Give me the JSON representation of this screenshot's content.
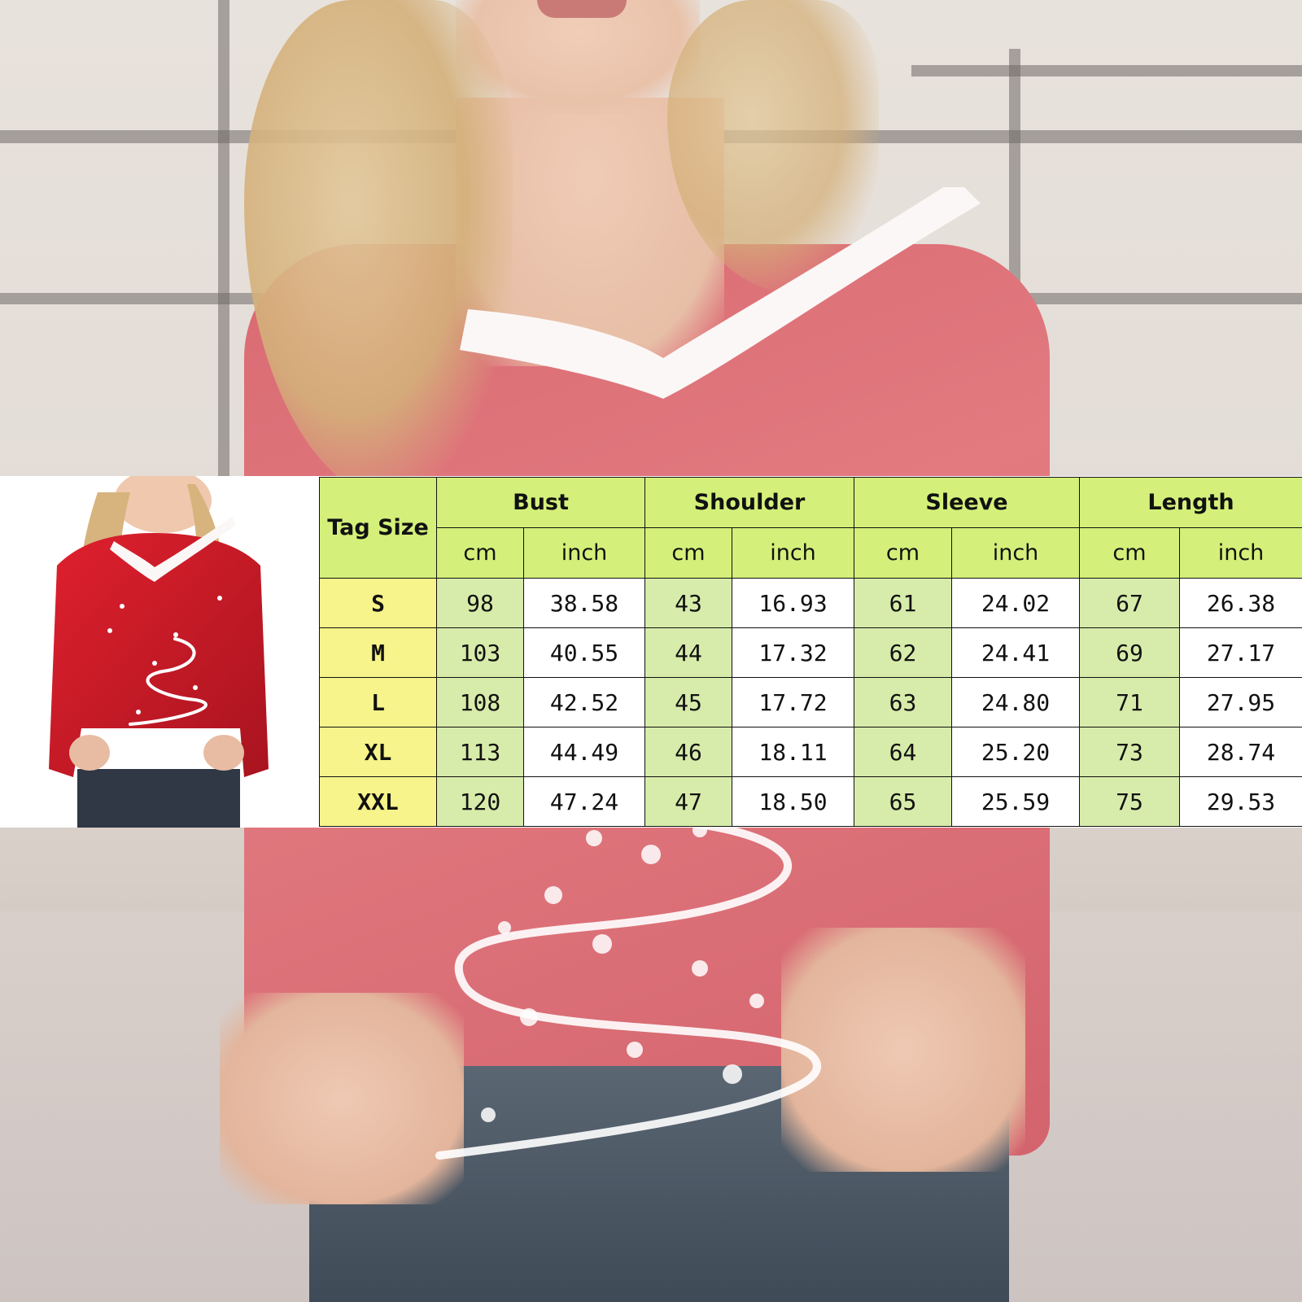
{
  "size_chart": {
    "headers": {
      "tag_size": "Tag Size",
      "groups": [
        "Bust",
        "Shoulder",
        "Sleeve",
        "Length"
      ],
      "units": [
        "cm",
        "inch",
        "cm",
        "inch",
        "cm",
        "inch",
        "cm",
        "inch"
      ]
    },
    "rows": [
      {
        "size": "S",
        "values": [
          "98",
          "38.58",
          "43",
          "16.93",
          "61",
          "24.02",
          "67",
          "26.38"
        ]
      },
      {
        "size": "M",
        "values": [
          "103",
          "40.55",
          "44",
          "17.32",
          "62",
          "24.41",
          "69",
          "27.17"
        ]
      },
      {
        "size": "L",
        "values": [
          "108",
          "42.52",
          "45",
          "17.72",
          "63",
          "24.80",
          "71",
          "27.95"
        ]
      },
      {
        "size": "XL",
        "values": [
          "113",
          "44.49",
          "46",
          "18.11",
          "64",
          "25.20",
          "73",
          "28.74"
        ]
      },
      {
        "size": "XXL",
        "values": [
          "120",
          "47.24",
          "47",
          "18.50",
          "65",
          "25.59",
          "75",
          "29.53"
        ]
      }
    ]
  },
  "colors": {
    "header_green": "#d4f07a",
    "cm_column_green": "#d7ecaa",
    "tag_column_yellow": "#f6f48a",
    "shirt_red": "#c8202c"
  }
}
